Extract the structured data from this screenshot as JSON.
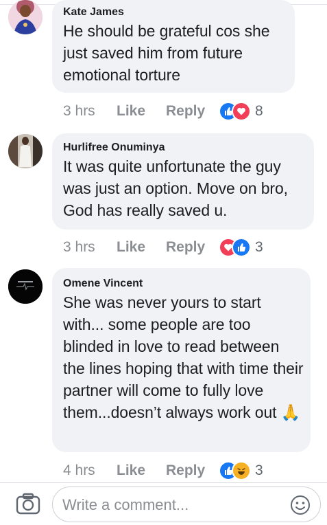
{
  "comments": [
    {
      "author": "Kate James",
      "text": "He should be grateful cos she just saved him from future emotional torture",
      "time": "3 hrs",
      "like_label": "Like",
      "reply_label": "Reply",
      "reactions": [
        "like",
        "love"
      ],
      "reaction_count": "8"
    },
    {
      "author": "Hurlifree Onuminya",
      "text": "It was quite unfortunate the guy was just an option. Move on bro, God has really saved u.",
      "time": "3 hrs",
      "like_label": "Like",
      "reply_label": "Reply",
      "reactions": [
        "love",
        "like"
      ],
      "reaction_count": "3"
    },
    {
      "author": "Omene Vincent",
      "text": "She was never yours to start with... some people are too blinded in love to read between the lines hoping that with time their partner will come to fully love them...doesn’t always work out",
      "emoji": "🙏",
      "time": "4 hrs",
      "like_label": "Like",
      "reply_label": "Reply",
      "reactions": [
        "like",
        "haha"
      ],
      "reaction_count": "3"
    }
  ],
  "composer": {
    "placeholder": "Write a comment..."
  },
  "colors": {
    "bubble": "#f0f2f5",
    "meta": "#8a8d91",
    "like_blue": "#1877f2",
    "love_red": "#f33e58",
    "haha_yellow": "#f7b125"
  },
  "icons": [
    "camera-icon",
    "emoji-icon",
    "like-reaction-icon",
    "love-reaction-icon",
    "haha-reaction-icon"
  ]
}
